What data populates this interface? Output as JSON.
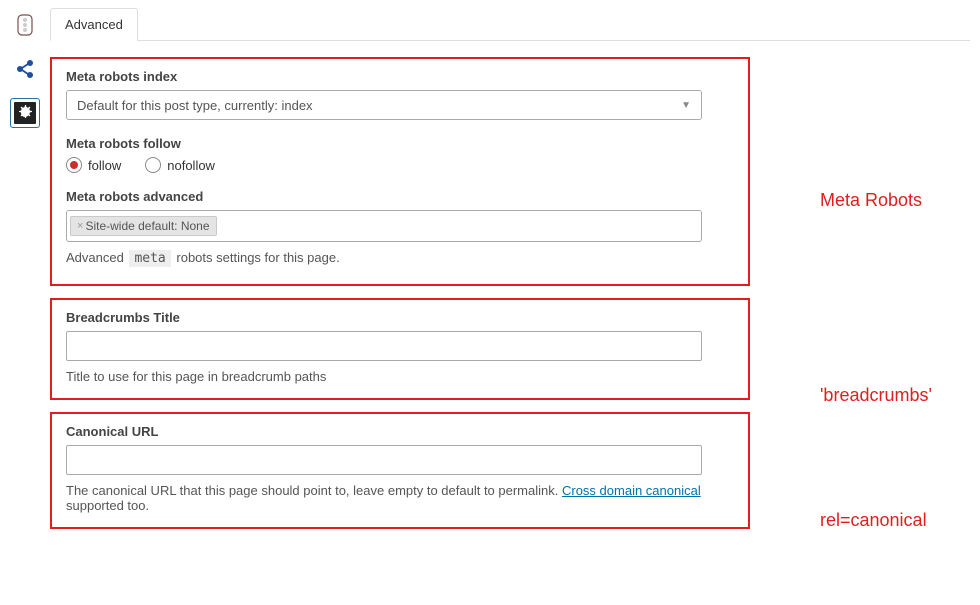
{
  "tab_label": "Advanced",
  "meta_robots": {
    "index_label": "Meta robots index",
    "index_value": "Default for this post type, currently: index",
    "follow_label": "Meta robots follow",
    "follow_option": "follow",
    "nofollow_option": "nofollow",
    "advanced_label": "Meta robots advanced",
    "advanced_tag": "Site-wide default: None",
    "advanced_help_pre": "Advanced",
    "advanced_help_code": "meta",
    "advanced_help_post": "robots settings for this page."
  },
  "breadcrumbs": {
    "label": "Breadcrumbs Title",
    "value": "",
    "help": "Title to use for this page in breadcrumb paths"
  },
  "canonical": {
    "label": "Canonical URL",
    "value": "",
    "help_pre": "The canonical URL that this page should point to, leave empty to default to permalink. ",
    "help_link": "Cross domain canonical",
    "help_post": " supported too."
  },
  "annotations": {
    "a1": "Meta Robots",
    "a2": "'breadcrumbs'",
    "a3": "rel=canonical"
  }
}
